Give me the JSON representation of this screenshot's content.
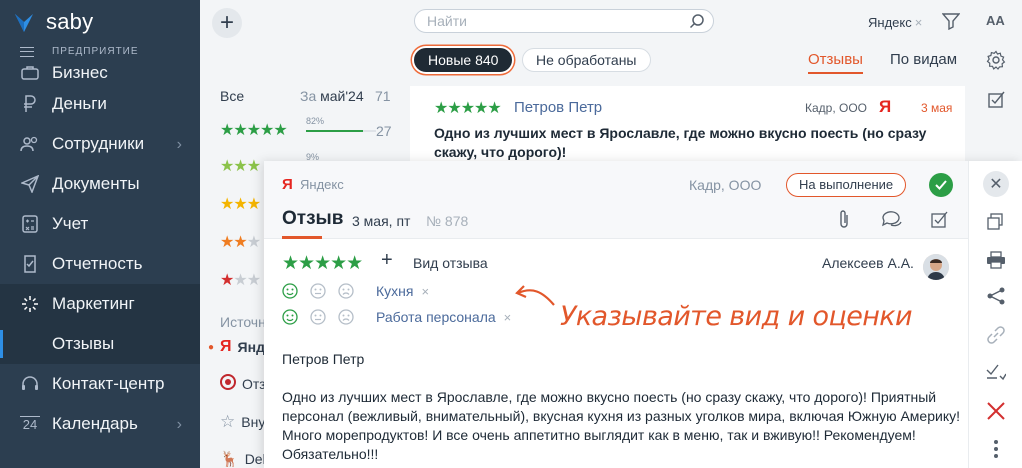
{
  "app": {
    "brand": "saby",
    "organization": "ПРЕДПРИЯТИЕ"
  },
  "sidebar": {
    "items": [
      {
        "label": "Бизнес",
        "icon": "briefcase-icon"
      },
      {
        "label": "Деньги",
        "icon": "money-icon"
      },
      {
        "label": "Сотрудники",
        "icon": "employees-icon",
        "has_children": true
      },
      {
        "label": "Документы",
        "icon": "paper-plane-icon"
      },
      {
        "label": "Учет",
        "icon": "calculator-icon"
      },
      {
        "label": "Отчетность",
        "icon": "report-icon"
      },
      {
        "label": "Маркетинг",
        "icon": "marketing-icon",
        "active": true
      },
      {
        "label": "Контакт-центр",
        "icon": "headset-icon"
      },
      {
        "label": "Календарь",
        "icon": "calendar-icon",
        "badge": "24",
        "has_children": true
      }
    ],
    "active_sub": "Отзывы"
  },
  "toolbar": {
    "search_placeholder": "Найти",
    "source_filter": "Яндекс",
    "font_size_label": "AA"
  },
  "filters": {
    "chip_new": "Новые 840",
    "chip_unprocessed": "Не обработаны",
    "tab_reviews": "Отзывы",
    "tab_by_kind": "По видам"
  },
  "stats": {
    "all_label": "Все",
    "range_prefix": "За",
    "range_value": "май'24",
    "total": "71",
    "rating_5_percent": "82%",
    "rating_5_fraction": 0.82,
    "rating_5_count": "27",
    "rating_4_percent": "9%",
    "sources_label": "Источники",
    "sources": [
      {
        "label": "Яндекс",
        "icon": "yandex-icon",
        "active": true
      },
      {
        "label": "Отзовик",
        "icon": "otzovik-icon"
      },
      {
        "label": "Внутренние",
        "icon": "star-outline-icon"
      },
      {
        "label": "Delivery",
        "icon": "delivery-icon"
      }
    ]
  },
  "list": {
    "stars": "★★★★★",
    "author": "Петров Петр",
    "company": "Кадр, ООО",
    "source_letter": "Я",
    "date": "3 мая",
    "text": "Одно из лучших мест в Ярославле, где можно вкусно поесть (но сразу скажу, что дорого)!"
  },
  "panel": {
    "source_letter": "Я",
    "source_name": "Яндекс",
    "company": "Кадр, ООО",
    "status": "На выполнение",
    "title": "Отзыв",
    "date": "3 мая, пт",
    "number": "№ 878",
    "stars": "★★★★★",
    "add_kind": "+",
    "kind_label": "Вид отзыва",
    "assignee": "Алексеев А.А.",
    "aspects": [
      {
        "label": "Кухня"
      },
      {
        "label": "Работа персонала"
      }
    ],
    "hint": "Указывайте вид и оценки",
    "author": "Петров Петр",
    "body": "Одно из лучших мест в Ярославле, где можно вкусно поесть (но сразу скажу, что дорого)! Приятный персонал (вежливый, внимательный), вкусная кухня из разных уголков мира, включая Южную Америку! Много морепродуктов! И все очень аппетитно выглядит как в меню, так и вживую!! Рекомендуем! Обязательно!!!"
  },
  "colors": {
    "sidebar_bg": "#2c3e50",
    "accent_orange": "#e2572b",
    "rating_green": "#2c9e46",
    "yandex_red": "#e52620",
    "link_blue": "#4b6a9b"
  }
}
